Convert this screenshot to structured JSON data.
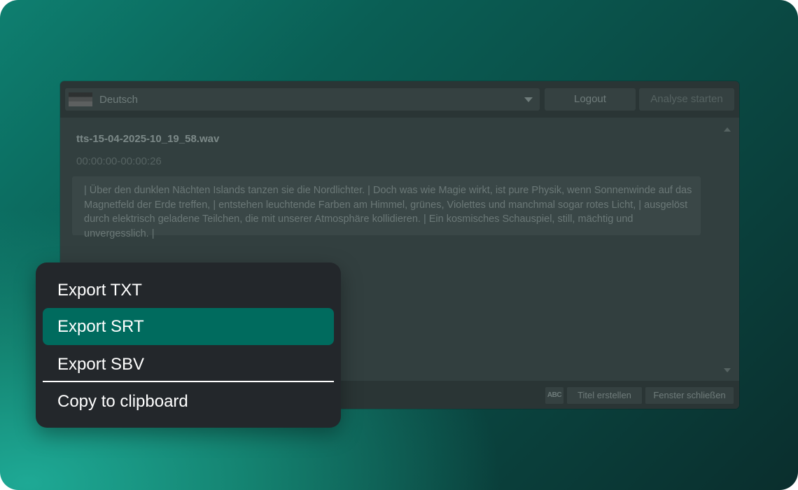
{
  "toolbar": {
    "language": "Deutsch",
    "logout_label": "Logout",
    "analyse_label": "Analyse starten"
  },
  "content": {
    "file_name": "tts-15-04-2025-10_19_58.wav",
    "time_range": "00:00:00-00:00:26",
    "transcript": "| Über den dunklen Nächten Islands tanzen sie die Nordlichter. | Doch was wie Magie wirkt, ist pure Physik, wenn Sonnenwinde auf das Magnetfeld der Erde treffen, | entstehen leuchtende Farben am Himmel, grünes, Violettes und manchmal sogar rotes Licht, | ausgelöst durch elektrisch geladene Teilchen, die mit unserer Atmosphäre kollidieren. | Ein kosmisches Schauspiel, still, mächtig und unvergesslich. |"
  },
  "statusbar": {
    "spellcheck_label": "ABC",
    "titel_label": "Titel erstellen",
    "close_label": "Fenster schließen"
  },
  "menu": {
    "items": [
      {
        "label": "Export TXT"
      },
      {
        "label": "Export SRT"
      },
      {
        "label": "Export SBV"
      },
      {
        "label": "Copy to clipboard"
      }
    ]
  },
  "colors": {
    "menu_background": "#23272b",
    "menu_highlight": "#006b5e",
    "window_background": "#2f3d3d"
  }
}
